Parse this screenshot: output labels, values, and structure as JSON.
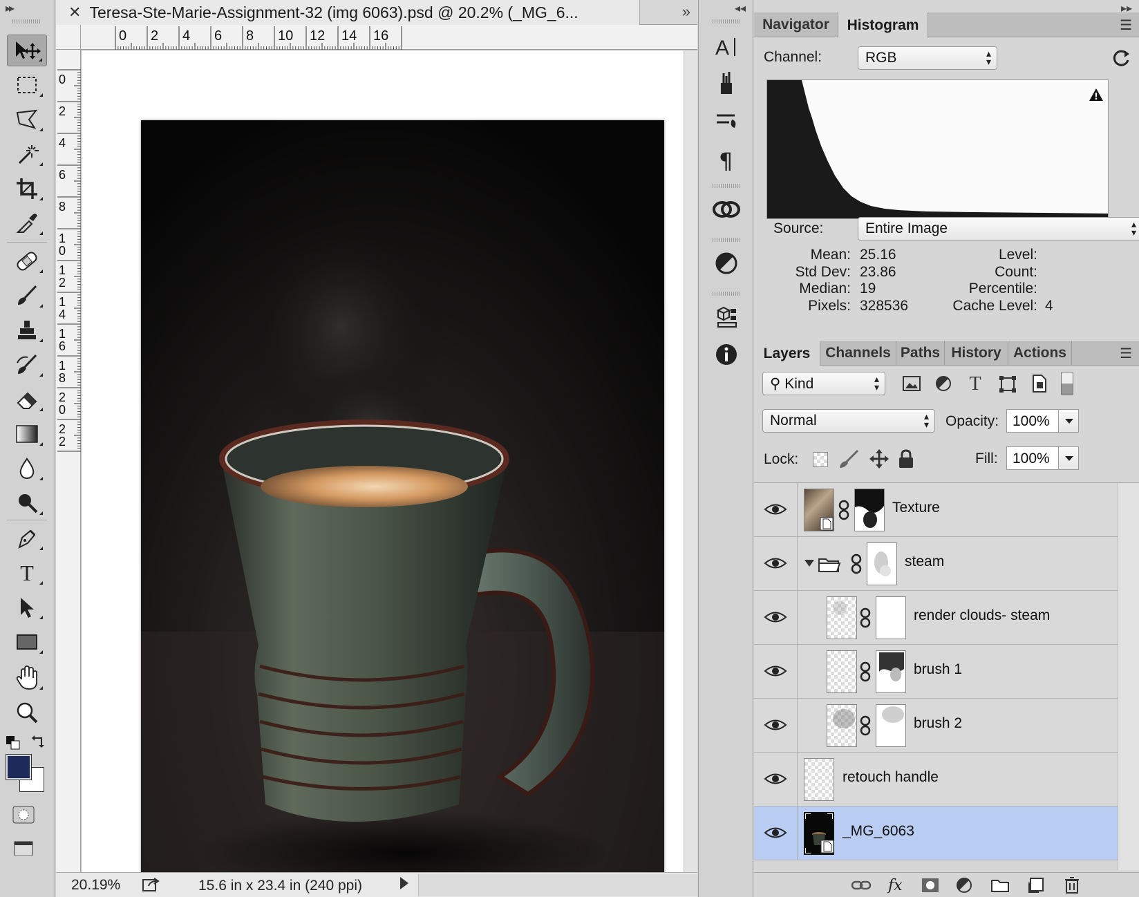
{
  "document": {
    "tab_title": "Teresa-Ste-Marie-Assignment-32 (img 6063).psd @ 20.2% (_MG_6...",
    "ruler_top_labels": [
      "0",
      "2",
      "4",
      "6",
      "8",
      "10",
      "12",
      "14",
      "16"
    ],
    "ruler_left_labels": [
      "0",
      "2",
      "4",
      "6",
      "8",
      "1\n0",
      "1\n2",
      "1\n4",
      "1\n6",
      "1\n8",
      "2\n0",
      "2\n2"
    ],
    "zoom": "20.19%",
    "doc_info": "15.6 in x 23.4 in (240 ppi)"
  },
  "toolbar": {
    "tools": [
      "move-tool",
      "rectangular-marquee-tool",
      "polygonal-lasso-tool",
      "magic-wand-tool",
      "crop-tool",
      "eyedropper-tool",
      "healing-brush-tool",
      "brush-tool",
      "clone-stamp-tool",
      "history-brush-tool",
      "eraser-tool",
      "gradient-tool",
      "blur-tool",
      "dodge-tool",
      "pen-tool",
      "type-tool",
      "path-selection-tool",
      "rectangle-tool",
      "hand-tool",
      "zoom-tool"
    ],
    "foreground_color": "#1e2a5a",
    "background_color": "#ffffff"
  },
  "histogram_panel": {
    "tabs": [
      "Navigator",
      "Histogram"
    ],
    "active_tab": "Histogram",
    "channel_label": "Channel:",
    "channel_value": "RGB",
    "source_label": "Source:",
    "source_value": "Entire Image",
    "stats": {
      "mean_label": "Mean:",
      "mean": "25.16",
      "std_label": "Std Dev:",
      "std": "23.86",
      "median_label": "Median:",
      "median": "19",
      "pixels_label": "Pixels:",
      "pixels": "328536",
      "level_label": "Level:",
      "count_label": "Count:",
      "percentile_label": "Percentile:",
      "cache_label": "Cache Level:",
      "cache": "4"
    }
  },
  "layers_panel": {
    "tabs": [
      "Layers",
      "Channels",
      "Paths",
      "History",
      "Actions"
    ],
    "active_tab": "Layers",
    "filter_value": "Kind",
    "blend_mode": "Normal",
    "opacity_label": "Opacity:",
    "opacity": "100%",
    "lock_label": "Lock:",
    "fill_label": "Fill:",
    "fill": "100%",
    "layers": [
      {
        "name": "Texture",
        "selected": false
      },
      {
        "name": "steam",
        "selected": false
      },
      {
        "name": "render clouds- steam",
        "selected": false
      },
      {
        "name": "brush 1",
        "selected": false
      },
      {
        "name": "brush 2",
        "selected": false
      },
      {
        "name": "retouch handle",
        "selected": false
      },
      {
        "name": "_MG_6063",
        "selected": true
      }
    ]
  },
  "colors": {
    "selection": "#b9cdf3",
    "panel": "#d6d6d6"
  }
}
